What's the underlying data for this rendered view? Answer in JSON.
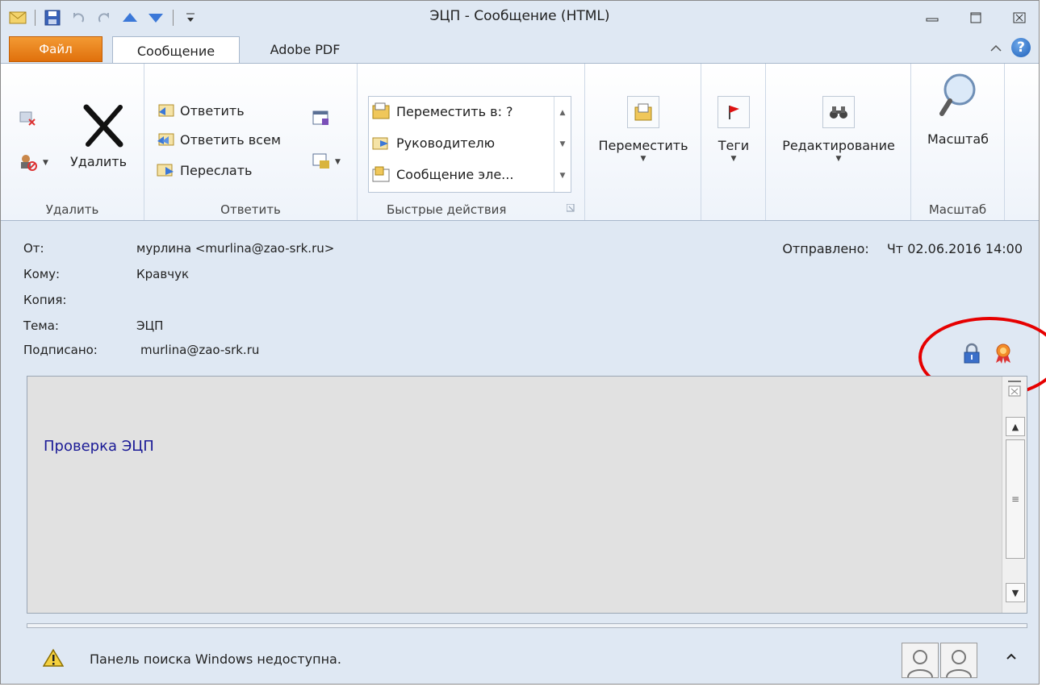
{
  "window": {
    "title": "ЭЦП - Сообщение (HTML)",
    "controls": {
      "minimize": "▭",
      "restore": "▫",
      "close": "☒"
    }
  },
  "qat": {
    "separator": "|"
  },
  "tabs": {
    "file": "Файл",
    "items": [
      "Сообщение",
      "Adobe PDF"
    ],
    "active": "Сообщение"
  },
  "ribbon": {
    "delete_group": {
      "label": "Удалить",
      "delete_button": "Удалить"
    },
    "respond_group": {
      "label": "Ответить",
      "reply": "Ответить",
      "reply_all": "Ответить всем",
      "forward": "Переслать"
    },
    "quick_steps": {
      "label": "Быстрые действия",
      "items": [
        "Переместить в: ?",
        "Руководителю",
        "Сообщение эле..."
      ]
    },
    "move": {
      "label": "Переместить"
    },
    "tags": {
      "label": "Теги"
    },
    "editing": {
      "label": "Редактирование"
    },
    "zoom": {
      "label": "Масштаб",
      "group_label": "Масштаб"
    }
  },
  "header": {
    "from_label": "От:",
    "from_value": "мурлина <murlina@zao-srk.ru>",
    "to_label": "Кому:",
    "to_value": "Кравчук",
    "cc_label": "Копия:",
    "cc_value": "",
    "subject_label": "Тема:",
    "subject_value": "ЭЦП",
    "signed_label": "Подписано:",
    "signed_value": "murlina@zao-srk.ru",
    "sent_label": "Отправлено:",
    "sent_value": "Чт 02.06.2016 14:00"
  },
  "body": {
    "text": "Проверка ЭЦП"
  },
  "people_pane": {
    "text": "Панель поиска Windows недоступна."
  },
  "colors": {
    "file_tab": "#e8801a",
    "highlight": "#e60000",
    "body_text": "#1a1a96"
  }
}
